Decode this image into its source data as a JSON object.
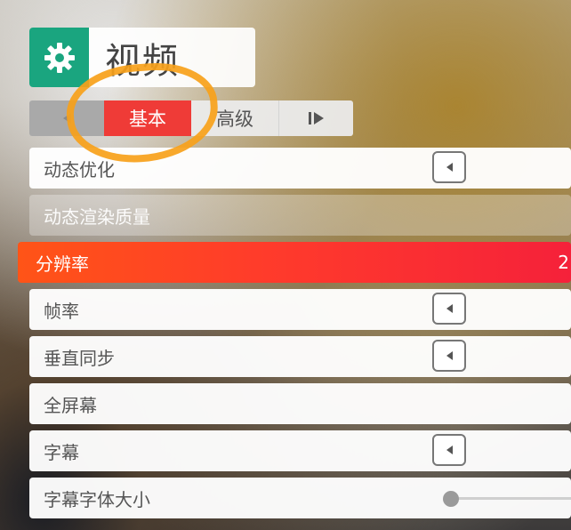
{
  "header": {
    "title": "视频",
    "icon": "gear-icon",
    "icon_bg_color": "#1aa57f"
  },
  "tabs": {
    "prev_icon": "chevron-left-icon",
    "items": [
      {
        "label": "基本",
        "selected": true
      },
      {
        "label": "高级",
        "selected": false
      }
    ],
    "next_icon": "skip-forward-icon",
    "active_color": "#ef3b37"
  },
  "settings": [
    {
      "label": "动态优化",
      "control": "arrow"
    },
    {
      "label": "动态渲染质量",
      "control": "none",
      "state": "disabled"
    },
    {
      "label": "分辨率",
      "control": "value",
      "value": "2",
      "state": "highlighted"
    },
    {
      "label": "帧率",
      "control": "arrow"
    },
    {
      "label": "垂直同步",
      "control": "arrow"
    },
    {
      "label": "全屏幕",
      "control": "none"
    },
    {
      "label": "字幕",
      "control": "arrow"
    },
    {
      "label": "字幕字体大小",
      "control": "slider",
      "slider_value": 0
    }
  ],
  "colors": {
    "highlight_start": "#ff5417",
    "highlight_end": "#f5213a",
    "annotation": "#f7a11a"
  }
}
